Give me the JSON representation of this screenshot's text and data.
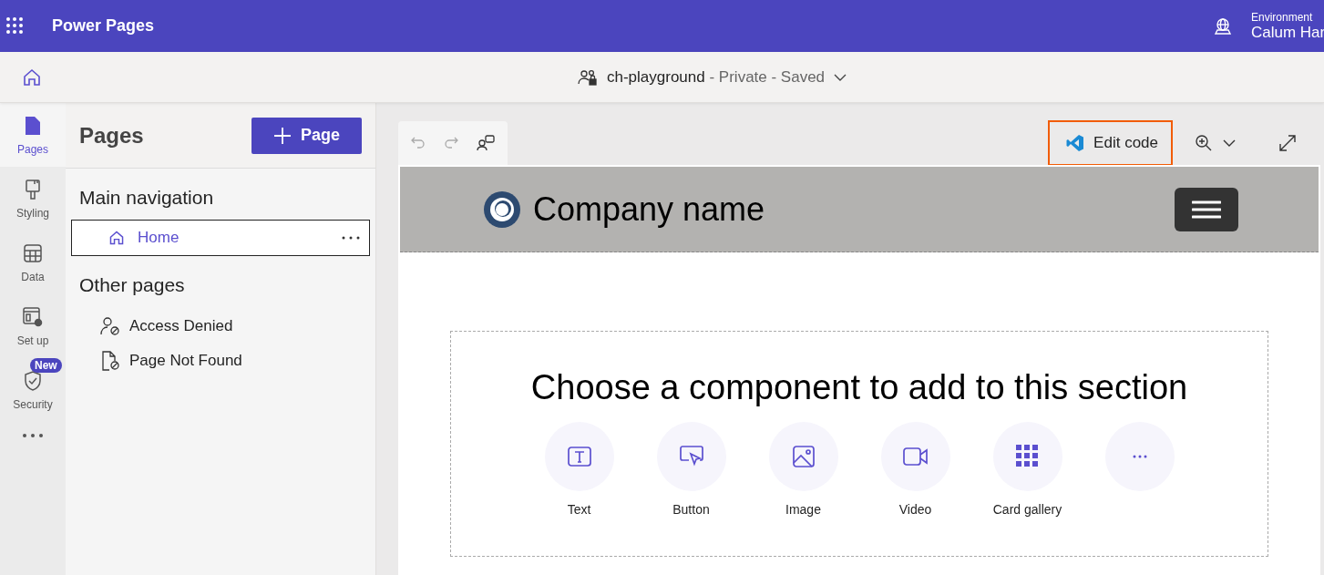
{
  "app": {
    "title": "Power Pages",
    "environment_label": "Environment",
    "environment_value": "Calum Har"
  },
  "site": {
    "name": "ch-playground",
    "status": " - Private - Saved"
  },
  "rail": [
    {
      "label": "Pages",
      "kind": "pages",
      "selected": true
    },
    {
      "label": "Styling",
      "kind": "styling",
      "selected": false
    },
    {
      "label": "Data",
      "kind": "data",
      "selected": false
    },
    {
      "label": "Set up",
      "kind": "setup",
      "selected": false
    },
    {
      "label": "Security",
      "kind": "security",
      "selected": false,
      "badge": "New"
    }
  ],
  "sidebar": {
    "title": "Pages",
    "add_button": "Page",
    "main_heading": "Main navigation",
    "main_items": [
      {
        "label": "Home",
        "selected": true
      }
    ],
    "other_heading": "Other pages",
    "other_items": [
      {
        "label": "Access Denied",
        "kind": "access"
      },
      {
        "label": "Page Not Found",
        "kind": "notfound"
      }
    ]
  },
  "toolbar": {
    "edit_code": "Edit code"
  },
  "preview": {
    "company": "Company name",
    "prompt": "Choose a component to add to this section",
    "components": [
      {
        "label": "Text",
        "kind": "text"
      },
      {
        "label": "Button",
        "kind": "button"
      },
      {
        "label": "Image",
        "kind": "image"
      },
      {
        "label": "Video",
        "kind": "video"
      },
      {
        "label": "Card gallery",
        "kind": "gallery"
      },
      {
        "kind": "more"
      }
    ]
  }
}
